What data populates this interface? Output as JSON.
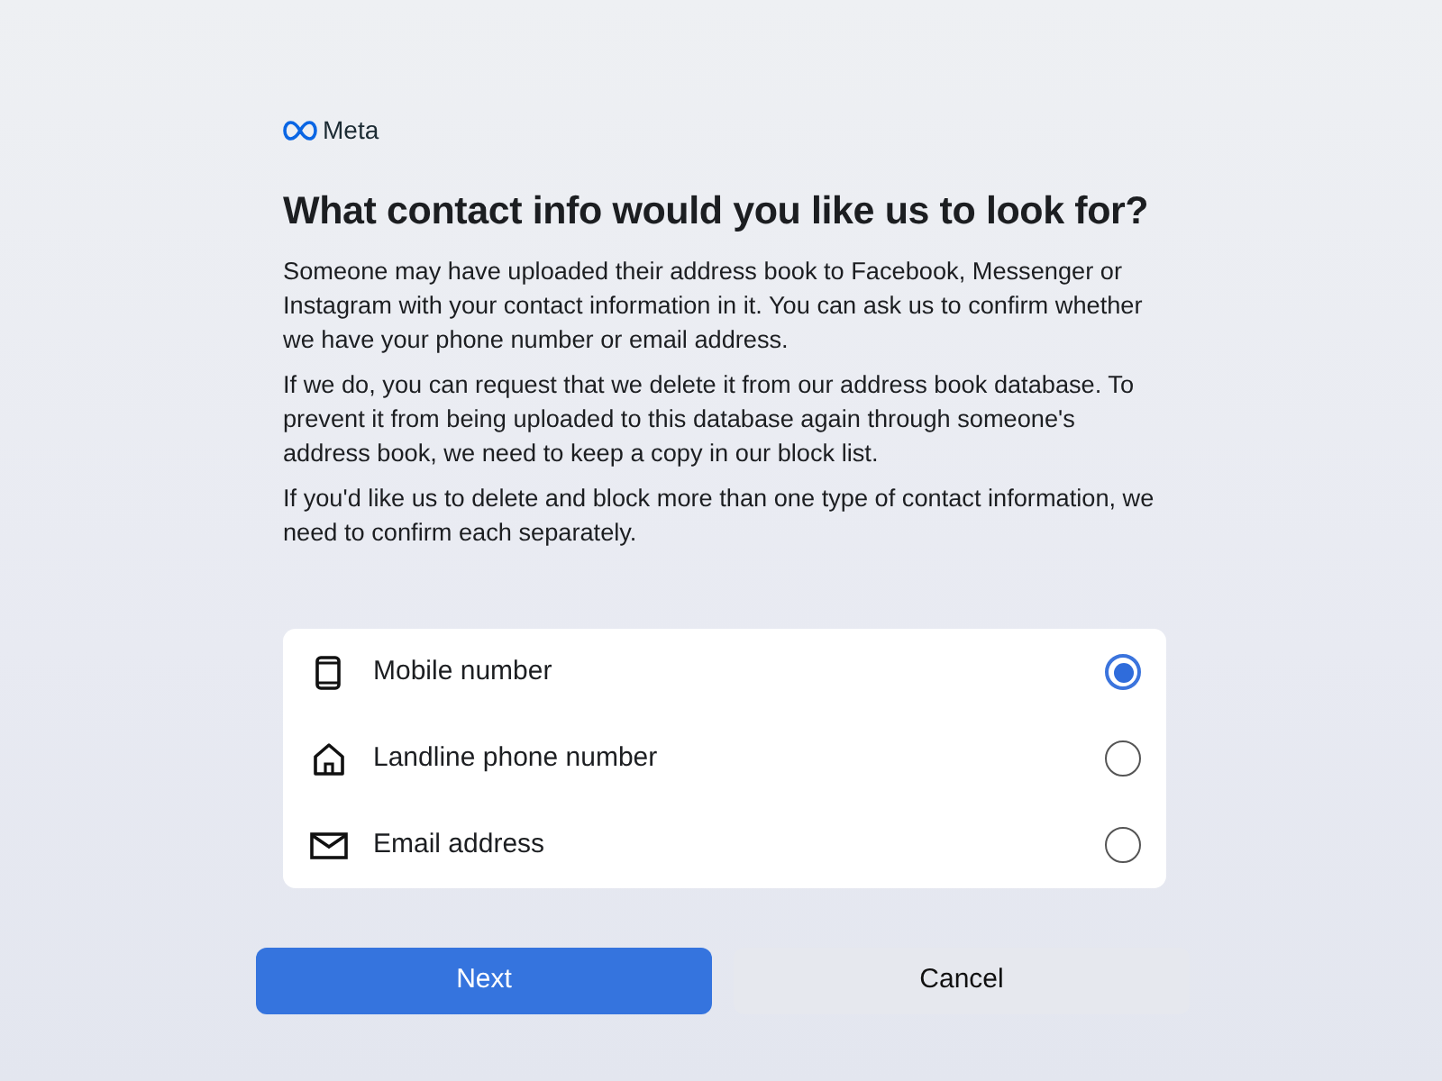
{
  "brand": {
    "name": "Meta"
  },
  "title": "What contact info would you like us to look for?",
  "paragraphs": [
    "Someone may have uploaded their address book to Facebook, Messenger or Instagram with your contact information in it. You can ask us to confirm whether we have your phone number or email address.",
    "If we do, you can request that we delete it from our address book database. To prevent it from being uploaded to this database again through someone's address book, we need to keep a copy in our block list.",
    "If you'd like us to delete and block more than one type of contact information, we need to confirm each separately."
  ],
  "options": [
    {
      "kind": "mobile",
      "label": "Mobile number",
      "selected": true
    },
    {
      "kind": "landline",
      "label": "Landline phone number",
      "selected": false
    },
    {
      "kind": "email",
      "label": "Email address",
      "selected": false
    }
  ],
  "buttons": [
    {
      "kind": "primary",
      "label": "Next"
    },
    {
      "kind": "secondary",
      "label": "Cancel"
    }
  ]
}
